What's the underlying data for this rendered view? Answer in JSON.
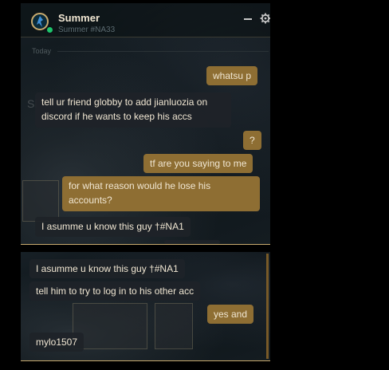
{
  "header": {
    "name": "Summer",
    "tag": "Summer #NA33"
  },
  "day_divider": "Today",
  "messages_top": [
    {
      "direction": "outgoing",
      "text": "whatsu p"
    },
    {
      "direction": "incoming",
      "text": "tell ur friend globby to add jianluozia on discord if he wants to keep his accs"
    },
    {
      "direction": "outgoing",
      "text": "?"
    },
    {
      "direction": "outgoing",
      "text": "tf are you saying to me"
    },
    {
      "direction": "outgoing",
      "text": "for what reason would he lose his accounts?"
    },
    {
      "direction": "incoming",
      "text": "I asumme u know this guy †#NA1"
    }
  ],
  "messages_bottom": [
    {
      "direction": "incoming",
      "text": "I asumme u know this guy †#NA1"
    },
    {
      "direction": "incoming",
      "text": "tell him to try to log in to his other acc"
    },
    {
      "direction": "outgoing",
      "text": "yes and"
    },
    {
      "direction": "incoming",
      "text": "mylo1507"
    }
  ],
  "colors": {
    "gold": "#c8aa6e",
    "outgoing_bubble": "#8e6e33",
    "incoming_bubble": "#1e2328",
    "online": "#1ec46b",
    "text": "#f0e6d2"
  },
  "icons": {
    "avatar": "profile-icon",
    "minimize": "minimize-icon",
    "settings": "gear-icon"
  }
}
